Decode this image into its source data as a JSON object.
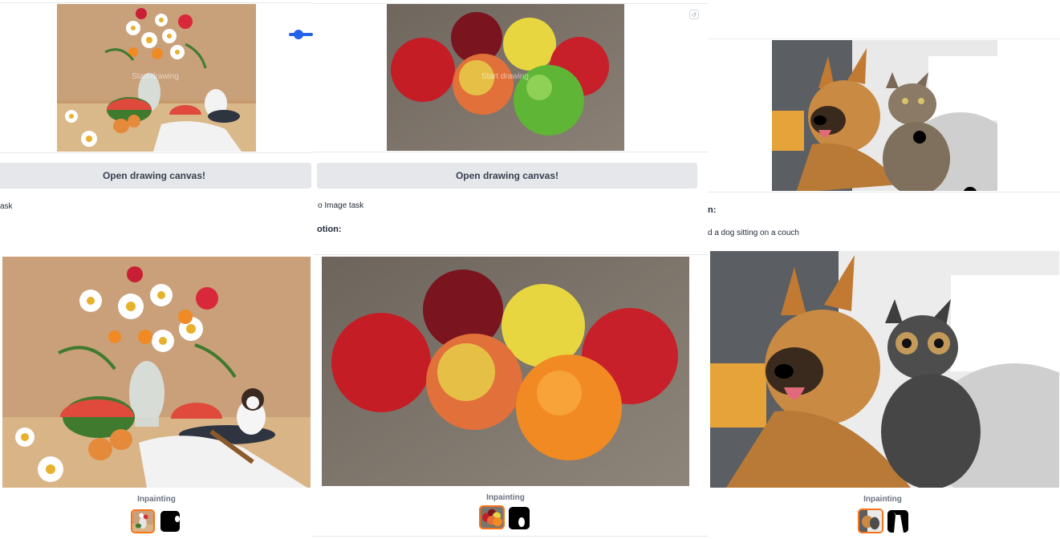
{
  "panels": [
    {
      "overlay_text": "Start drawing",
      "button_label": "Open drawing canvas!",
      "task_text": "ask",
      "caption": "Inpainting"
    },
    {
      "overlay_text": "Start drawing",
      "button_label": "Open drawing canvas!",
      "task_text": "o Image task",
      "section_label": "otion:",
      "caption": "Inpainting"
    },
    {
      "section_label": "n:",
      "prompt_text": "d a dog sitting on a couch",
      "caption": "Inpainting"
    }
  ],
  "colors": {
    "accent_blue": "#2563eb",
    "selected_border": "#f97316",
    "button_bg": "#e5e7eb"
  },
  "icons": {
    "undo": "undo-icon"
  }
}
